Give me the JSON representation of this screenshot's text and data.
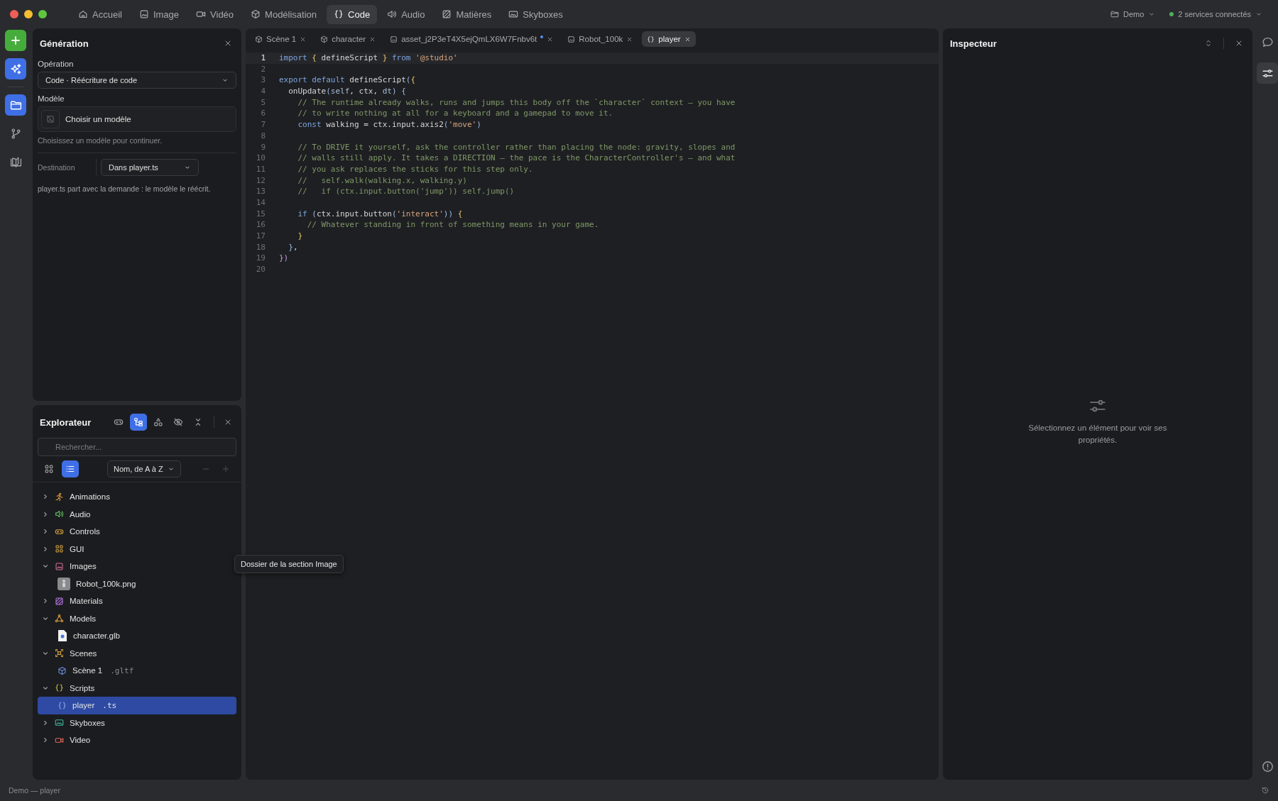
{
  "nav": [
    {
      "label": "Accueil",
      "kind": "home",
      "selected": false
    },
    {
      "label": "Image",
      "kind": "image",
      "selected": false
    },
    {
      "label": "Vidéo",
      "kind": "video",
      "selected": false
    },
    {
      "label": "Modélisation",
      "kind": "model",
      "selected": false
    },
    {
      "label": "Code",
      "kind": "code",
      "selected": true
    },
    {
      "label": "Audio",
      "kind": "audio",
      "selected": false
    },
    {
      "label": "Matières",
      "kind": "materials",
      "selected": false
    },
    {
      "label": "Skyboxes",
      "kind": "skybox",
      "selected": false
    }
  ],
  "project": {
    "label": "Demo"
  },
  "services": {
    "label": "2 services connectés",
    "connected": true
  },
  "rail": [
    {
      "kind": "generate",
      "selected": true
    },
    {
      "kind": "files",
      "selected": true
    },
    {
      "kind": "branches",
      "selected": false
    },
    {
      "kind": "docs",
      "selected": false
    }
  ],
  "generation": {
    "title": "Génération",
    "operation_label": "Opération",
    "operation": "Code · Réécriture de code",
    "model_label": "Modèle",
    "model_placeholder": "Choisir un modèle",
    "model_hint": "Choisissez un modèle pour continuer.",
    "destination_label": "Destination",
    "destination": "Dans player.ts",
    "note": "player.ts part avec la demande : le modèle le réécrit."
  },
  "explorer": {
    "title": "Explorateur",
    "tools": [
      {
        "kind": "links",
        "selected": false
      },
      {
        "kind": "hierarchy",
        "selected": true
      },
      {
        "kind": "shapes",
        "selected": false
      },
      {
        "kind": "hidden",
        "selected": false
      },
      {
        "kind": "collapse",
        "selected": false
      }
    ],
    "search": {
      "placeholder": "Rechercher..."
    },
    "views": [
      {
        "kind": "grid",
        "selected": false
      },
      {
        "kind": "list",
        "selected": true
      }
    ],
    "sort": "Nom, de A à Z",
    "actions": [
      {
        "kind": "remove",
        "disabled": true
      },
      {
        "kind": "add",
        "disabled": true
      }
    ],
    "tree": [
      {
        "label": "Animations",
        "kind": "animation",
        "expanded": false,
        "selected": false
      },
      {
        "label": "Audio",
        "kind": "audio",
        "expanded": false,
        "selected": false
      },
      {
        "label": "Controls",
        "kind": "controls",
        "expanded": false,
        "selected": false
      },
      {
        "label": "GUI",
        "kind": "gui",
        "expanded": false,
        "selected": false
      },
      {
        "label": "Images",
        "kind": "images",
        "expanded": true,
        "selected": false,
        "children": [
          {
            "label": "Robot_100k.png",
            "kind": "thumbnail",
            "selected": false
          }
        ]
      },
      {
        "label": "Materials",
        "kind": "materials",
        "expanded": false,
        "selected": false
      },
      {
        "label": "Models",
        "kind": "models",
        "expanded": true,
        "selected": false,
        "children": [
          {
            "label": "character.glb",
            "kind": "document",
            "selected": false
          }
        ]
      },
      {
        "label": "Scenes",
        "kind": "scenes",
        "expanded": true,
        "selected": false,
        "children": [
          {
            "label": "Scène 1",
            "ext": ".gltf",
            "kind": "scene",
            "selected": false
          }
        ]
      },
      {
        "label": "Scripts",
        "kind": "scripts",
        "expanded": true,
        "selected": false,
        "children": [
          {
            "label": "player",
            "ext": ".ts",
            "kind": "script",
            "selected": true
          }
        ]
      },
      {
        "label": "Skyboxes",
        "kind": "skyboxes",
        "expanded": false,
        "selected": false
      },
      {
        "label": "Video",
        "kind": "video",
        "expanded": false,
        "selected": false
      }
    ]
  },
  "tooltip": "Dossier de la section Image",
  "tabs": [
    {
      "label": "Scène 1",
      "kind": "scene",
      "modified": false,
      "selected": false
    },
    {
      "label": "character",
      "kind": "model",
      "modified": false,
      "selected": false
    },
    {
      "label": "asset_j2P3eT4X5ejQmLX6W7Fnbv6t",
      "kind": "image",
      "modified": true,
      "selected": false
    },
    {
      "label": "Robot_100k",
      "kind": "image",
      "modified": false,
      "selected": false
    },
    {
      "label": "player",
      "kind": "script",
      "modified": false,
      "selected": true
    }
  ],
  "editor": {
    "lines": [
      {
        "number": "1",
        "current": true,
        "tokens": [
          {
            "kind": "kw",
            "text": "import"
          },
          {
            "kind": "brace",
            "text": " {"
          },
          {
            "kind": "plain",
            "text": " defineScript "
          },
          {
            "kind": "brace",
            "text": "}"
          },
          {
            "kind": "kw",
            "text": " from"
          },
          {
            "kind": "str",
            "text": " '@studio'"
          }
        ]
      },
      {
        "number": "2",
        "current": false
      },
      {
        "number": "3",
        "current": false,
        "tokens": [
          {
            "kind": "kw",
            "text": "export default"
          },
          {
            "kind": "plain",
            "text": " defineScript"
          },
          {
            "kind": "paren",
            "text": "("
          },
          {
            "kind": "brace",
            "text": "{"
          }
        ]
      },
      {
        "number": "4",
        "current": false,
        "tokens": [
          {
            "kind": "plain",
            "text": "  onUpdate"
          },
          {
            "kind": "paren",
            "text": "("
          },
          {
            "kind": "param",
            "text": "self"
          },
          {
            "kind": "plain",
            "text": ", ctx, "
          },
          {
            "kind": "param",
            "text": "dt"
          },
          {
            "kind": "paren",
            "text": ")"
          },
          {
            "kind": "paren",
            "text": " {"
          }
        ]
      },
      {
        "number": "5",
        "current": false,
        "tokens": [
          {
            "kind": "com",
            "text": "    // The runtime already walks, runs and jumps this body off the `character` context — you have"
          }
        ]
      },
      {
        "number": "6",
        "current": false,
        "tokens": [
          {
            "kind": "com",
            "text": "    // to write nothing at all for a keyboard and a gamepad to move it."
          }
        ]
      },
      {
        "number": "7",
        "current": false,
        "tokens": [
          {
            "kind": "kw",
            "text": "    const"
          },
          {
            "kind": "plain",
            "text": " walking = ctx.input.axis2"
          },
          {
            "kind": "paren",
            "text": "("
          },
          {
            "kind": "str",
            "text": "'move'"
          },
          {
            "kind": "paren",
            "text": ")"
          }
        ]
      },
      {
        "number": "8",
        "current": false
      },
      {
        "number": "9",
        "current": false,
        "tokens": [
          {
            "kind": "com",
            "text": "    // To DRIVE it yourself, ask the controller rather than placing the node: gravity, slopes and"
          }
        ]
      },
      {
        "number": "10",
        "current": false,
        "tokens": [
          {
            "kind": "com",
            "text": "    // walls still apply. It takes a DIRECTION — the pace is the CharacterController's — and what"
          }
        ]
      },
      {
        "number": "11",
        "current": false,
        "tokens": [
          {
            "kind": "com",
            "text": "    // you ask replaces the sticks for this step only."
          }
        ]
      },
      {
        "number": "12",
        "current": false,
        "tokens": [
          {
            "kind": "com",
            "text": "    //   self.walk(walking.x, walking.y)"
          }
        ]
      },
      {
        "number": "13",
        "current": false,
        "tokens": [
          {
            "kind": "com",
            "text": "    //   if (ctx.input.button('jump')) self.jump()"
          }
        ]
      },
      {
        "number": "14",
        "current": false
      },
      {
        "number": "15",
        "current": false,
        "tokens": [
          {
            "kind": "kw",
            "text": "    if"
          },
          {
            "kind": "paren",
            "text": " ("
          },
          {
            "kind": "plain",
            "text": "ctx.input.button"
          },
          {
            "kind": "paren",
            "text": "("
          },
          {
            "kind": "str",
            "text": "'interact'"
          },
          {
            "kind": "paren",
            "text": "))"
          },
          {
            "kind": "brace",
            "text": " {"
          }
        ]
      },
      {
        "number": "16",
        "current": false,
        "tokens": [
          {
            "kind": "com",
            "text": "      // Whatever standing in front of something means in your game."
          }
        ]
      },
      {
        "number": "17",
        "current": false,
        "tokens": [
          {
            "kind": "brace",
            "text": "    }"
          }
        ]
      },
      {
        "number": "18",
        "current": false,
        "tokens": [
          {
            "kind": "paren",
            "text": "  }"
          },
          {
            "kind": "plain",
            "text": ","
          }
        ]
      },
      {
        "number": "19",
        "current": false,
        "tokens": [
          {
            "kind": "purple",
            "text": "})"
          }
        ]
      },
      {
        "number": "20",
        "current": false
      }
    ]
  },
  "inspector": {
    "title": "Inspecteur",
    "empty_text": "Sélectionnez un élément pour voir ses propriétés."
  },
  "right_rail": [
    {
      "kind": "comments",
      "selected": false
    },
    {
      "kind": "properties",
      "selected": true
    }
  ],
  "status_bar": "Demo — player"
}
